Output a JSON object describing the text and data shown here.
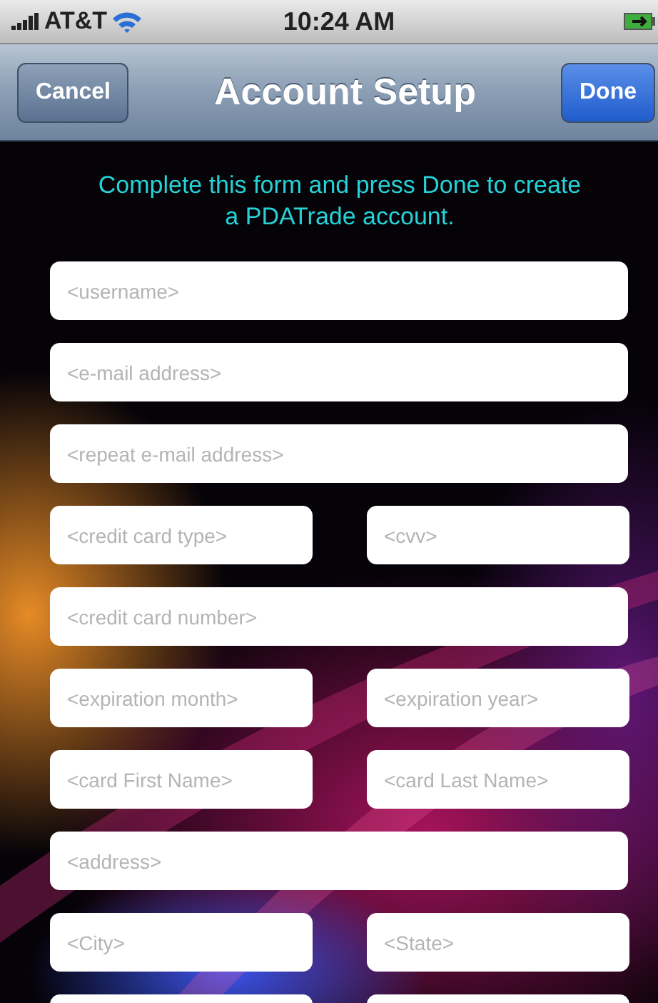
{
  "status_bar": {
    "carrier": "AT&T",
    "time": "10:24 AM"
  },
  "nav_bar": {
    "title": "Account Setup",
    "left_button": "Cancel",
    "right_button": "Done"
  },
  "intro": "Complete this form and press Done to create a PDATrade account.",
  "form_rows": [
    [
      {
        "placeholder": "<username>"
      }
    ],
    [
      {
        "placeholder": "<e-mail address>"
      }
    ],
    [
      {
        "placeholder": "<repeat e-mail address>"
      }
    ],
    [
      {
        "placeholder": "<credit card type>"
      },
      {
        "placeholder": "<cvv>"
      }
    ],
    [
      {
        "placeholder": "<credit card number>"
      }
    ],
    [
      {
        "placeholder": "<expiration month>"
      },
      {
        "placeholder": "<expiration year>"
      }
    ],
    [
      {
        "placeholder": "<card First Name>"
      },
      {
        "placeholder": "<card Last Name>"
      }
    ],
    [
      {
        "placeholder": "<address>"
      }
    ],
    [
      {
        "placeholder": "<City>"
      },
      {
        "placeholder": "<State>"
      }
    ],
    [
      {
        "kind": "field"
      },
      {
        "kind": "field"
      }
    ]
  ]
}
